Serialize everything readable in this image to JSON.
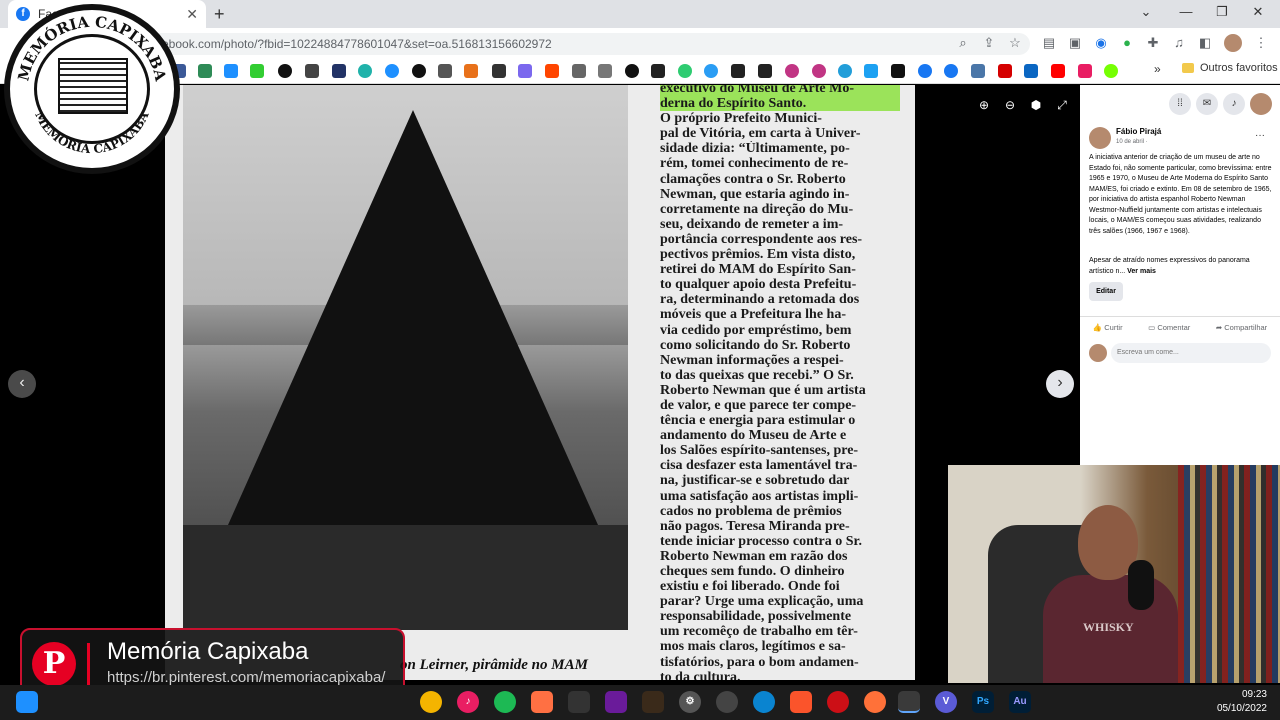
{
  "browser": {
    "tab_title": "Fac",
    "favicon": "f",
    "url": "ebook.com/photo/?fbid=10224884778601047&set=oa.516813156602972",
    "bookmarks_folder_label": "Outros favoritos",
    "window_controls": [
      "⌄",
      "—",
      "❐",
      "✕"
    ]
  },
  "badge": {
    "ring_top": "MEMÓRIA CAPIXABA",
    "ring_bottom": "MEMÓRIA CAPIXABA"
  },
  "photo_viewer": {
    "caption": "on Leirner, pirâmide no MAM",
    "article_lines": [
      "executivo do Museu de Arte Mo-",
      "derna do Espírito Santo.",
      "   O próprio Prefeito Munici-",
      "pal de Vitória, em carta à Univer-",
      "sidade dizia: “Ùltimamente, po-",
      "rém, tomei conhecimento de re-",
      "clamações contra o Sr. Roberto",
      "Newman, que estaria agindo in-",
      "corretamente na direção do Mu-",
      "seu, deixando de remeter a im-",
      "portância correspondente aos res-",
      "pectivos prêmios. Em vista disto,",
      "retirei do MAM do Espírito San-",
      "to qualquer apoio desta Prefeitu-",
      "ra, determinando a retomada dos",
      "móveis que a Prefeitura lhe ha-",
      "via cedido por empréstimo, bem",
      "como solicitando do Sr. Roberto",
      "Newman informações a respei-",
      "to das queixas que recebi.” O Sr.",
      "Roberto Newman que é um artista",
      "de valor, e que  parece ter compe-",
      "tência e energia para estimular o",
      "andamento do Museu de Arte e",
      "los Salões espírito-santenses, pre-",
      "cisa desfazer esta lamentável tra-",
      "na, justificar-se e sobretudo dar",
      "uma satisfação aos artistas impli-",
      "cados no problema  de prêmios",
      "não pagos. Teresa Miranda pre-",
      "tende iniciar processo contra o Sr.",
      "Roberto Newman em razão dos",
      "cheques sem fundo. O dinheiro",
      "existiu e foi liberado. Onde foi",
      "parar? Urge uma explicação, uma",
      "responsabilidade,  possivelmente",
      "um recomêço de trabalho em têr-",
      "mos mais claros, legítimos e sa-",
      "tisfatórios, para o bom andamen-",
      "to da cultura."
    ],
    "prev_arrow": "‹",
    "next_arrow": "›"
  },
  "post": {
    "author": "Fábio Pirajá",
    "date": "10 de abril · ",
    "text": "A iniciativa anterior de criação de um museu de arte no Estado foi, não somente particular, como brevíssima: entre 1965 e 1970, o Museu de Arte Moderna do Espírito Santo MAM/ES, foi criado e extinto. Em 08 de setembro de 1965, por iniciativa do artista espanhol Roberto Newman Westmor-Nuffield juntamente com artistas e intelectuais locais, o MAM/ES começou suas atividades, realizando três salões (1966, 1967 e 1968).",
    "text2": "Apesar de atraído nomes expressivos do panorama artístico n... ",
    "see_more": "Ver mais",
    "edit_label": "Editar",
    "like_label": "Curtir",
    "comment_label": "Comentar",
    "share_label": "Compartilhar",
    "comment_placeholder": "Escreva um come..."
  },
  "webcam": {
    "shirt_text": "WHISKY"
  },
  "pinterest": {
    "logo": "P",
    "title": "Memória Capixaba",
    "url": "https://br.pinterest.com/memoriacapixaba/"
  },
  "taskbar": {
    "time": "09:23",
    "date": "05/10/2022",
    "app_labels": [
      "V",
      "Ps",
      "Au"
    ]
  },
  "colors": {
    "facebook_blue": "#1877f2",
    "pinterest_red": "#e60023",
    "highlight_green": "#9be35a"
  }
}
